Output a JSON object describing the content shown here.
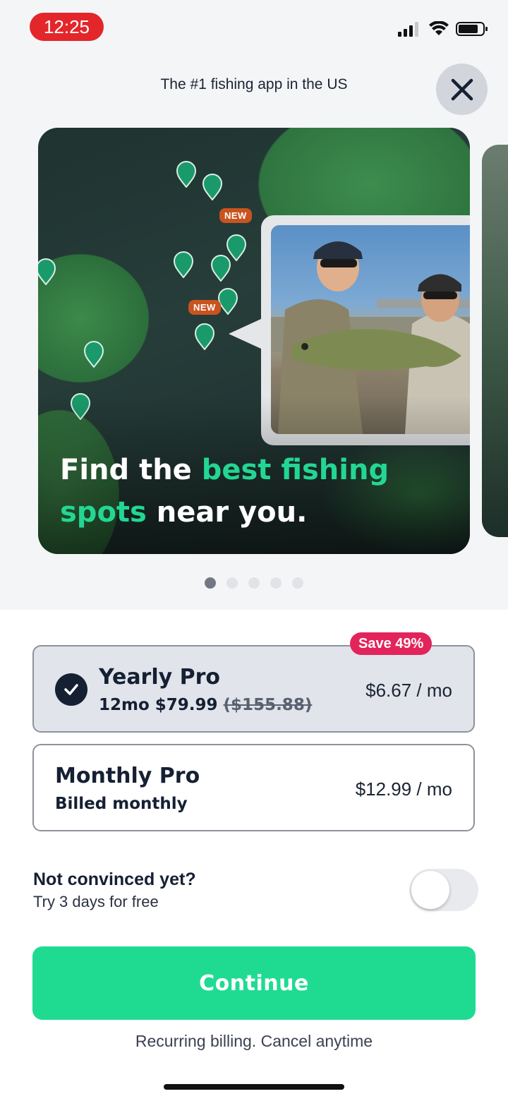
{
  "status_bar": {
    "time": "12:25",
    "icons": [
      "signal-icon",
      "wifi-icon",
      "battery-icon"
    ]
  },
  "header": {
    "title": "The #1 fishing app in the US",
    "close_icon": "close-icon"
  },
  "carousel": {
    "card": {
      "headline_part1": "Find the ",
      "headline_accent1": "best fishing",
      "headline_accent2": "spots",
      "headline_part2": " near you.",
      "new_tag": "NEW"
    },
    "page_count": 5,
    "active_page": 1
  },
  "plans": {
    "yearly": {
      "name": "Yearly Pro",
      "sub_price": "12mo $79.99 ",
      "original_price": "($155.88)",
      "price": "$6.67 / mo",
      "badge": "Save 49%",
      "selected": true
    },
    "monthly": {
      "name": "Monthly Pro",
      "sub": "Billed monthly",
      "price": "$12.99 / mo",
      "selected": false
    }
  },
  "trial": {
    "title": "Not convinced yet?",
    "subtitle": "Try 3 days for free",
    "enabled": false
  },
  "cta": {
    "label": "Continue"
  },
  "footnote": "Recurring billing. Cancel anytime",
  "colors": {
    "accent": "#1fdb92",
    "badge": "#e3245a",
    "dark": "#152033",
    "status_time_bg": "#e3262a"
  }
}
